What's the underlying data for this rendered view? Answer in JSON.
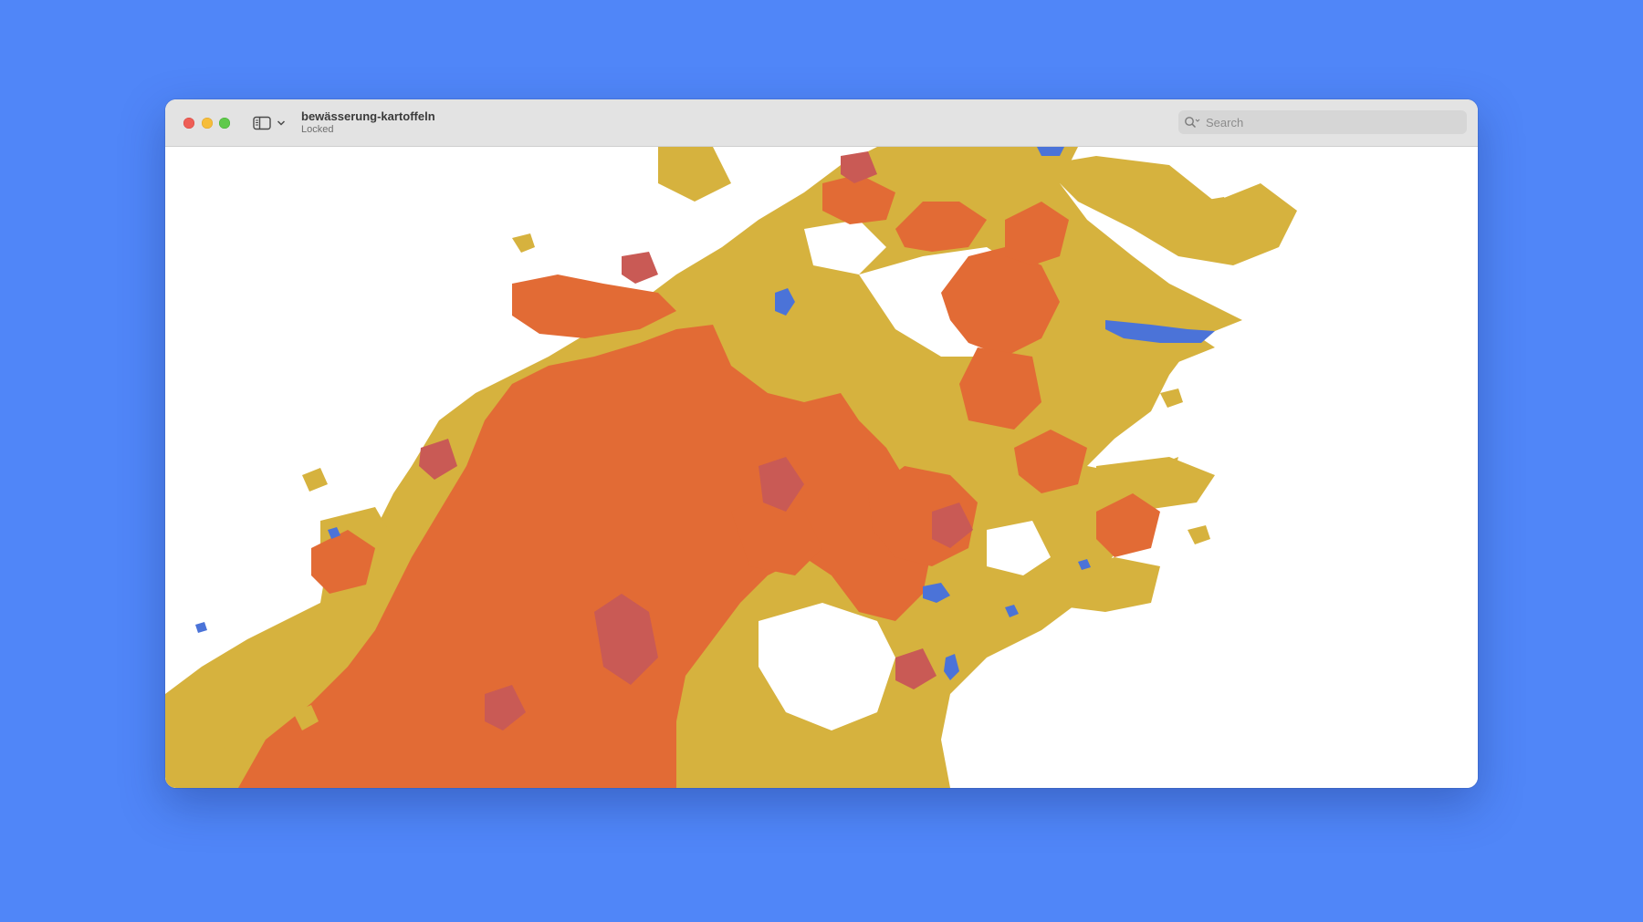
{
  "window": {
    "title": "bewässerung-kartoffeln",
    "subtitle": "Locked"
  },
  "toolbar": {
    "sidebar_toggle_icon": "sidebar-icon",
    "chevron_icon": "chevron-down-icon"
  },
  "search": {
    "placeholder": "Search",
    "icon": "magnifier-icon"
  },
  "map": {
    "colors": {
      "background": "#ffffff",
      "yellow": "#d6b23e",
      "orange": "#e26b35",
      "dark_red": "#c95a55",
      "blue": "#4b73d8"
    }
  },
  "colors": {
    "desktop": "#5086f8",
    "titlebar": "#e3e3e3",
    "traffic_close": "#ee5e56",
    "traffic_minimize": "#f6bd3b",
    "traffic_maximize": "#5fc94b"
  }
}
